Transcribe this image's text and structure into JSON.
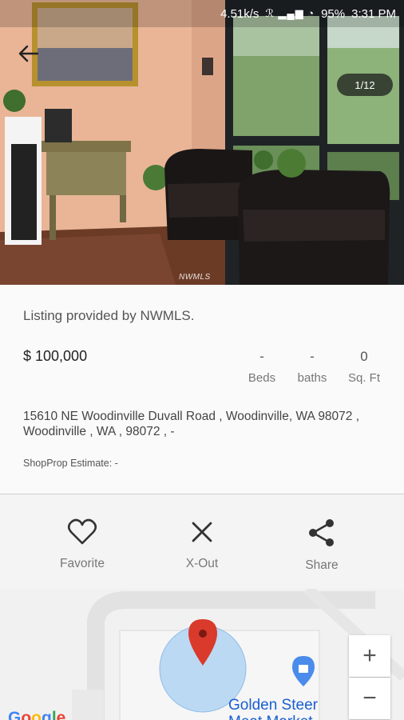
{
  "status_bar": {
    "speed": "4.51k/s",
    "signal_icons": "ℛ ▂▄▆ ◔",
    "battery": "95%",
    "time": "3:31 PM"
  },
  "gallery": {
    "counter": "1/12",
    "watermark": "NWMLS"
  },
  "listing": {
    "provided_by": "Listing provided by NWMLS.",
    "price": "$ 100,000",
    "stats": [
      {
        "value": "-",
        "label": "Beds"
      },
      {
        "value": "-",
        "label": "baths"
      },
      {
        "value": "0",
        "label": "Sq. Ft"
      }
    ],
    "address": "15610 NE Woodinville Duvall Road , Woodinville, WA 98072 , Woodinville , WA , 98072 , -",
    "estimate": "ShopProp Estimate: -"
  },
  "actions": {
    "favorite": "Favorite",
    "xout": "X-Out",
    "share": "Share"
  },
  "map": {
    "poi_line1": "Golden Steer",
    "poi_line2": "Meat Market",
    "zoom_in": "+",
    "zoom_out": "−",
    "provider": "Google"
  },
  "colors": {
    "marker_red": "#d93a2b",
    "accuracy_circle": "#a8cff2",
    "poi_blue": "#1a5fd1"
  }
}
